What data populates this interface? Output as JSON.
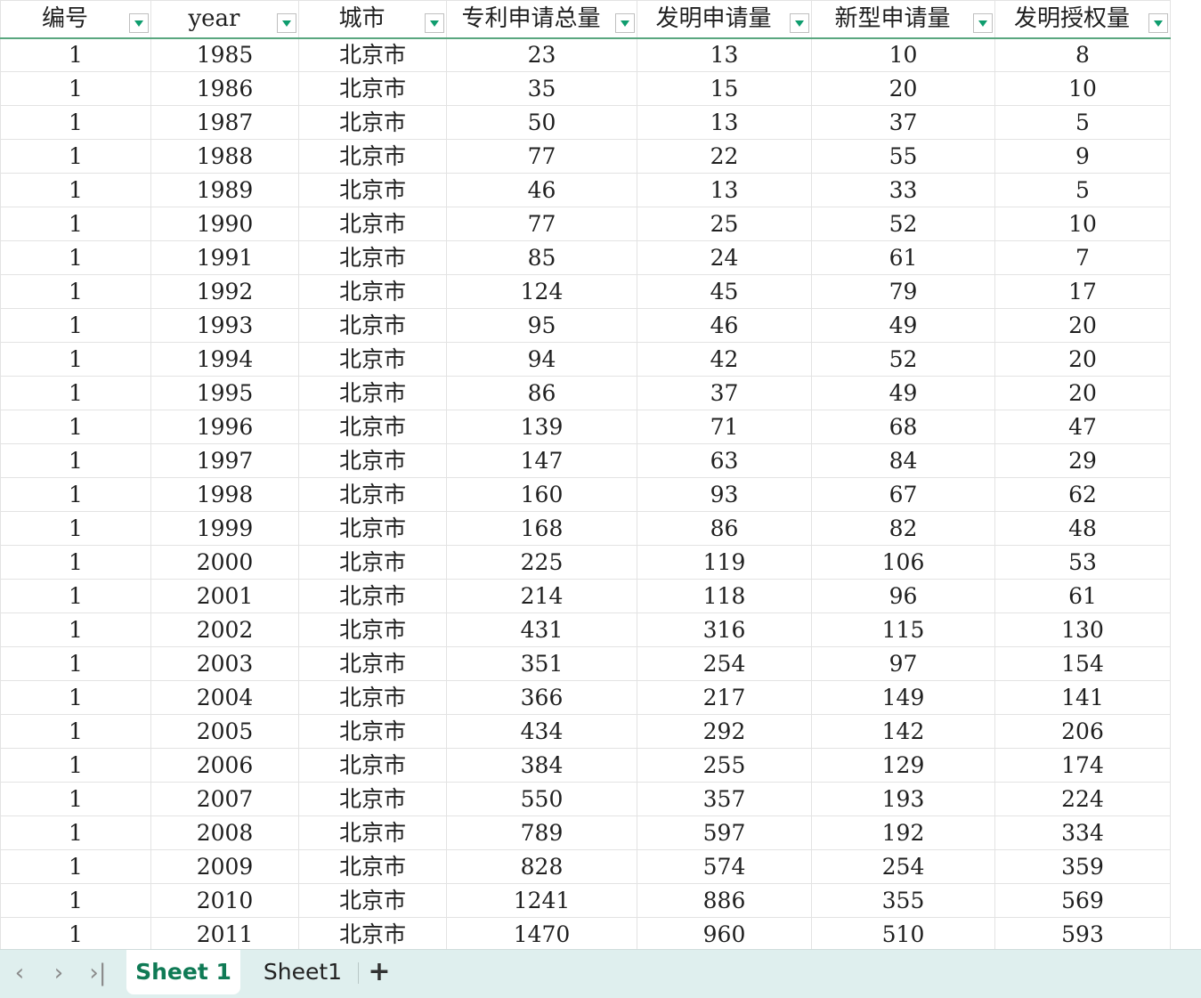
{
  "columns": [
    "编号",
    "year",
    "城市",
    "专利申请总量",
    "发明申请量",
    "新型申请量",
    "发明授权量"
  ],
  "rows": [
    [
      "1",
      "1985",
      "北京市",
      "23",
      "13",
      "10",
      "8"
    ],
    [
      "1",
      "1986",
      "北京市",
      "35",
      "15",
      "20",
      "10"
    ],
    [
      "1",
      "1987",
      "北京市",
      "50",
      "13",
      "37",
      "5"
    ],
    [
      "1",
      "1988",
      "北京市",
      "77",
      "22",
      "55",
      "9"
    ],
    [
      "1",
      "1989",
      "北京市",
      "46",
      "13",
      "33",
      "5"
    ],
    [
      "1",
      "1990",
      "北京市",
      "77",
      "25",
      "52",
      "10"
    ],
    [
      "1",
      "1991",
      "北京市",
      "85",
      "24",
      "61",
      "7"
    ],
    [
      "1",
      "1992",
      "北京市",
      "124",
      "45",
      "79",
      "17"
    ],
    [
      "1",
      "1993",
      "北京市",
      "95",
      "46",
      "49",
      "20"
    ],
    [
      "1",
      "1994",
      "北京市",
      "94",
      "42",
      "52",
      "20"
    ],
    [
      "1",
      "1995",
      "北京市",
      "86",
      "37",
      "49",
      "20"
    ],
    [
      "1",
      "1996",
      "北京市",
      "139",
      "71",
      "68",
      "47"
    ],
    [
      "1",
      "1997",
      "北京市",
      "147",
      "63",
      "84",
      "29"
    ],
    [
      "1",
      "1998",
      "北京市",
      "160",
      "93",
      "67",
      "62"
    ],
    [
      "1",
      "1999",
      "北京市",
      "168",
      "86",
      "82",
      "48"
    ],
    [
      "1",
      "2000",
      "北京市",
      "225",
      "119",
      "106",
      "53"
    ],
    [
      "1",
      "2001",
      "北京市",
      "214",
      "118",
      "96",
      "61"
    ],
    [
      "1",
      "2002",
      "北京市",
      "431",
      "316",
      "115",
      "130"
    ],
    [
      "1",
      "2003",
      "北京市",
      "351",
      "254",
      "97",
      "154"
    ],
    [
      "1",
      "2004",
      "北京市",
      "366",
      "217",
      "149",
      "141"
    ],
    [
      "1",
      "2005",
      "北京市",
      "434",
      "292",
      "142",
      "206"
    ],
    [
      "1",
      "2006",
      "北京市",
      "384",
      "255",
      "129",
      "174"
    ],
    [
      "1",
      "2007",
      "北京市",
      "550",
      "357",
      "193",
      "224"
    ],
    [
      "1",
      "2008",
      "北京市",
      "789",
      "597",
      "192",
      "334"
    ],
    [
      "1",
      "2009",
      "北京市",
      "828",
      "574",
      "254",
      "359"
    ],
    [
      "1",
      "2010",
      "北京市",
      "1241",
      "886",
      "355",
      "569"
    ],
    [
      "1",
      "2011",
      "北京市",
      "1470",
      "960",
      "510",
      "593"
    ]
  ],
  "sheet_tabs": [
    {
      "label": "Sheet 1",
      "active": true
    },
    {
      "label": "Sheet1",
      "active": false
    }
  ],
  "tabbar": {
    "prev_icon": "‹",
    "next_icon": "›",
    "last_icon": "›|",
    "add_icon": "+"
  },
  "icons": {
    "filter": "filter-dropdown-icon",
    "prev": "chevron-left-icon",
    "next": "chevron-right-icon",
    "last": "chevron-last-icon",
    "add": "plus-icon"
  },
  "colors": {
    "accent": "#0f9d6e",
    "active_tab_text": "#0f7a55",
    "tabbar_bg": "#dfefee",
    "header_underline": "#5aa77f",
    "grid_line": "#e3e3e3"
  }
}
